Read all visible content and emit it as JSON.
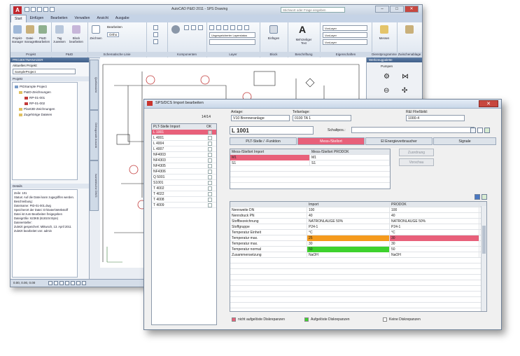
{
  "cad": {
    "app_icon": "A",
    "title": "AutoCAD P&ID 2011 - SPS Drawing",
    "search_placeholder": "Stichwort oder Frage eingeben",
    "tabs": [
      "Start",
      "Einfügen",
      "Bearbeiten",
      "Verwalten",
      "Ansicht",
      "Ausgabe"
    ],
    "active_tab": "Start",
    "ribbon": {
      "project_group": "Projekt",
      "pid_group": "P&ID",
      "project_buttons": [
        "Projekt-manager",
        "Datei-manager",
        "P&ID Bearbeiten"
      ],
      "pid_buttons": [
        "Tag zuweisen",
        "Block bearbeiten"
      ],
      "schematic_group": "Schematische Linie",
      "draw_button": "Zeichnen",
      "line_buttons": [
        "Bearbeiten",
        "Ortho"
      ],
      "component_group": "Komponenten",
      "layer_group": "Layer",
      "layer_value": "Ungespeicherter Layerstatus",
      "block_group": "Block",
      "block_button": "Einfügen",
      "annotation_group": "Beschriftung",
      "annotation_button": "Mehrzeiliger Text",
      "properties_group": "Eigenschaften",
      "by_layer": "VonLayer",
      "utilities_group": "Dienstprogramme",
      "measure_button": "Messen",
      "clipboard_group": "Zwischenablage"
    },
    "left_panel": {
      "header": "PROJEKTMANAGER",
      "current_project_label": "Aktuelles Projekt:",
      "current_project": "SampleProject",
      "project_section": "Projekt",
      "tree": [
        "PIDSample Project",
        "P&ID-Zeichnungen",
        "RP-01-001",
        "RP-01-002",
        "Plant3D-Zeichnungen",
        "Zugehörige Dateien"
      ],
      "details_header": "Details",
      "details": [
        "Zeile: 101",
        "Status: Auf die Datei kann zugegriffen werden.",
        "Beschreibung:",
        "Dateiname: PID-01-001.dwg",
        "Speicherort der Datei: D:\\Daten\\Werkstoff",
        "Datei ist zum Bearbeiten freigegeben",
        "Dateigröße: 623KB (618104 Byte)",
        "Dateiersteller:",
        "Zuletzt gespeichert: Mittwoch, 13. April 2011",
        "Zuletzt bearbeitet von: admin"
      ]
    },
    "side_tabs": [
      "Quellansicht",
      "Orthogonale Ansicht",
      "Isometrische DWG"
    ],
    "right_panel": {
      "header": "Werkzeugpalette",
      "section": "Pumpen"
    },
    "status_coords": "0.00, 0.00, 0.00"
  },
  "dialog": {
    "title": "SPS/DCS Import bearbeiten",
    "counter": "14/14",
    "list_header_name": "PLT-Stelle Import",
    "list_header_ok": "OK",
    "list_items": [
      "L 1001",
      "L 4001",
      "L 4004",
      "L 4007",
      "NF4003",
      "NF4303",
      "NF4305",
      "NF4306",
      "Q 5001",
      "S1001",
      "T 4002",
      "T 4022",
      "T 4008",
      "T 4009"
    ],
    "selected_item": "L 1001",
    "anlage_label": "Anlage:",
    "anlage_value": "V10 Brenneranlage",
    "teilanlage_label": "Teilanlage:",
    "teilanlage_value": "0100 TA 1",
    "ri_label": "R&I Fließbild:",
    "ri_value": "1000-4",
    "tag_title": "L 1001",
    "schaltpos_label": "Schaltpos.:",
    "tabs": [
      "PLT-Stelle / -Funktion",
      "Mess-/Stellort",
      "El Energieverbraucher",
      "Signale"
    ],
    "active_tab": "Mess-/Stellort",
    "map_headers": [
      "Mess-/Stellort Import",
      "Mess-/Stellort PRODOK"
    ],
    "map_rows": [
      [
        "M1",
        "M1"
      ],
      [
        "S1",
        "S1"
      ]
    ],
    "btn_zuordnung": "Zuordnung",
    "btn_vorschau": "Vorschau",
    "prop_headers": [
      "",
      "Import",
      "PRODOK"
    ],
    "prop_rows": [
      [
        "Nennweite DN",
        "100",
        "100",
        ""
      ],
      [
        "Nenndruck PN",
        "40",
        "40",
        ""
      ],
      [
        "Stoffbezeichnung",
        "NATRONLAUGE 50%",
        "NATRONLAUGE 50%",
        ""
      ],
      [
        "Stoffgruppe",
        "P24-1",
        "P24-1",
        ""
      ],
      [
        "Temperatur Einheit",
        "°C",
        "°C",
        ""
      ],
      [
        "Temperatur max.",
        "25",
        "30",
        "diff"
      ],
      [
        "Temperatur max.",
        "30",
        "30",
        ""
      ],
      [
        "Temperatur normal",
        "50",
        "50",
        "green"
      ],
      [
        "Zusammensetzung",
        "NaOH",
        "NaOH",
        ""
      ]
    ],
    "legend": {
      "not_resolved": "nicht aufgelöste Diskrepanzen",
      "resolved": "Aufgelöste Diskrepanzen",
      "none": "Keine Diskrepanzen"
    },
    "colors": {
      "discrepancy": "#e8607a",
      "resolved": "#3ed22e",
      "changed": "#f59a1c",
      "selection": "#4a78c2"
    }
  }
}
